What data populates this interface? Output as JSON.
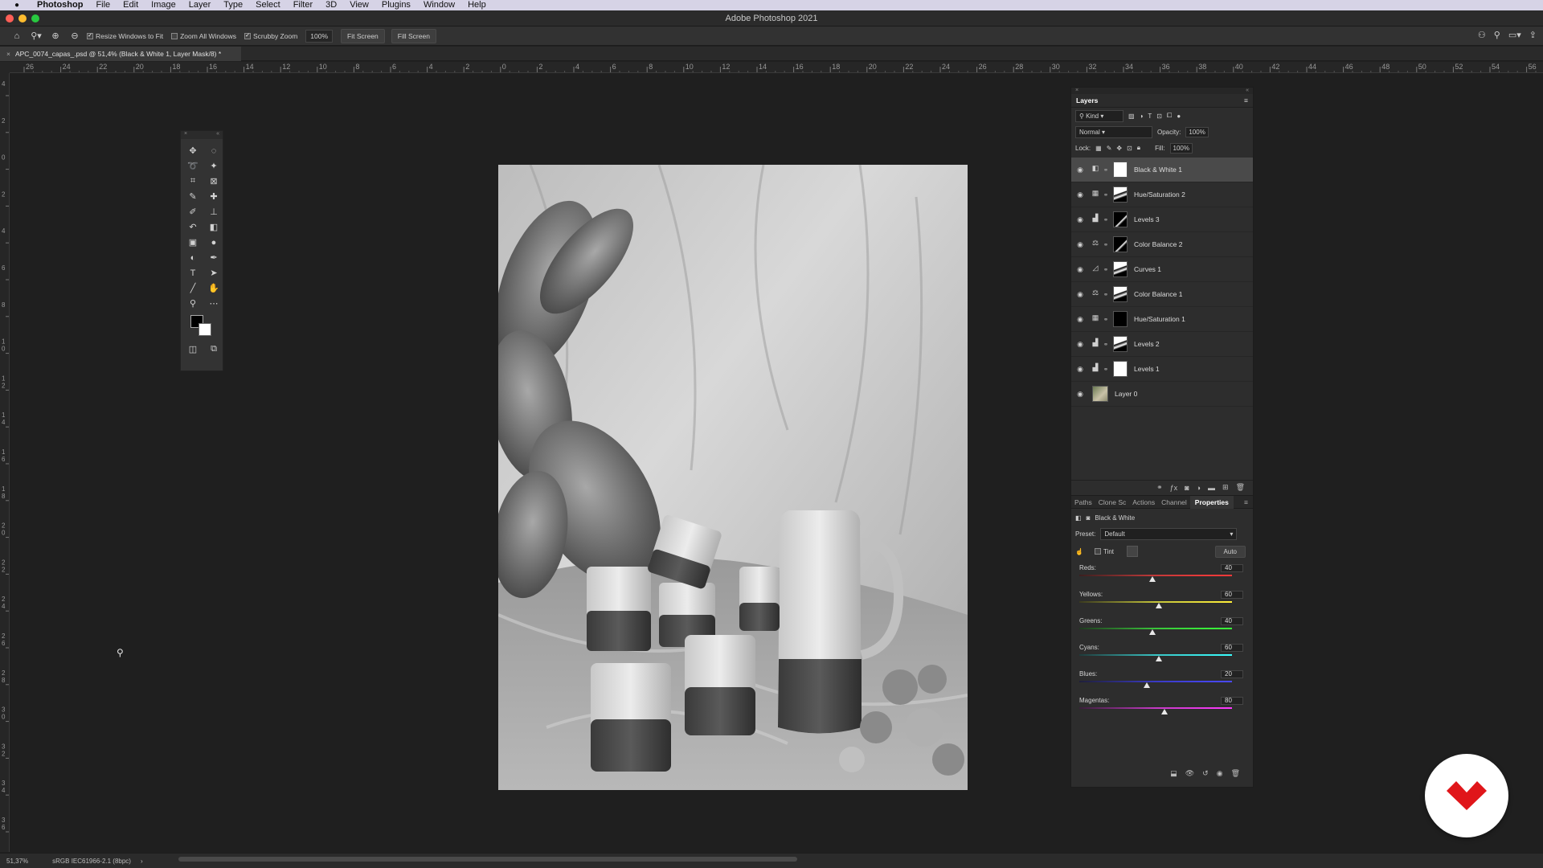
{
  "menubar": {
    "app": "Photoshop",
    "items": [
      "File",
      "Edit",
      "Image",
      "Layer",
      "Type",
      "Select",
      "Filter",
      "3D",
      "View",
      "Plugins",
      "Window",
      "Help"
    ]
  },
  "window": {
    "title": "Adobe Photoshop 2021"
  },
  "options": {
    "resize_windows": "Resize Windows to Fit",
    "zoom_all": "Zoom All Windows",
    "scrubby": "Scrubby Zoom",
    "zoom_value": "100%",
    "fit_screen": "Fit Screen",
    "fill_screen": "Fill Screen"
  },
  "document": {
    "tab_title": "APC_0074_capas_.psd @ 51,4% (Black & White 1, Layer Mask/8) *"
  },
  "rulers": {
    "h_ticks": [
      "26",
      "24",
      "22",
      "20",
      "18",
      "16",
      "14",
      "12",
      "10",
      "8",
      "6",
      "4",
      "2",
      "0",
      "2",
      "4",
      "6",
      "8",
      "10",
      "12",
      "14",
      "16",
      "18",
      "20",
      "22",
      "24",
      "26",
      "28",
      "30",
      "32",
      "34",
      "36",
      "38",
      "40",
      "42",
      "44",
      "46",
      "48",
      "50",
      "52",
      "54",
      "56"
    ],
    "v_ticks": [
      "4",
      "2",
      "0",
      "2",
      "4",
      "6",
      "8",
      "1\n0",
      "1\n2",
      "1\n4",
      "1\n6",
      "1\n8",
      "2\n0",
      "2\n2",
      "2\n4",
      "2\n6",
      "2\n8",
      "3\n0",
      "3\n2",
      "3\n4",
      "3\n6"
    ]
  },
  "layers_panel": {
    "tab": "Layers",
    "kind": "Kind",
    "blend_mode": "Normal",
    "opacity_label": "Opacity:",
    "opacity": "100%",
    "lock_label": "Lock:",
    "fill_label": "Fill:",
    "fill": "100%",
    "layers": [
      {
        "name": "Black & White 1",
        "icon": "bw-icon",
        "mask": "white",
        "selected": true
      },
      {
        "name": "Hue/Saturation 2",
        "icon": "huesat-icon",
        "mask": "mixed"
      },
      {
        "name": "Levels 3",
        "icon": "levels-icon",
        "mask": "dark"
      },
      {
        "name": "Color Balance 2",
        "icon": "colorbalance-icon",
        "mask": "dark"
      },
      {
        "name": "Curves 1",
        "icon": "curves-icon",
        "mask": "mixed"
      },
      {
        "name": "Color Balance 1",
        "icon": "colorbalance-icon",
        "mask": "mixed"
      },
      {
        "name": "Hue/Saturation 1",
        "icon": "huesat-icon",
        "mask": "black"
      },
      {
        "name": "Levels 2",
        "icon": "levels-icon",
        "mask": "mixed"
      },
      {
        "name": "Levels 1",
        "icon": "levels-icon",
        "mask": "white"
      },
      {
        "name": "Layer 0",
        "icon": "",
        "mask": "photo"
      }
    ]
  },
  "properties_tabs": [
    "Paths",
    "Clone Sc",
    "Actions",
    "Channel",
    "Properties"
  ],
  "properties": {
    "title": "Black & White",
    "preset_label": "Preset:",
    "preset": "Default",
    "tint": "Tint",
    "auto": "Auto",
    "sliders": [
      {
        "name": "Reds:",
        "value": 40,
        "pct": 0.48,
        "gradient": "linear-gradient(90deg,#3a1f1f,#c43a3a,#ff3a3a)"
      },
      {
        "name": "Yellows:",
        "value": 60,
        "pct": 0.52,
        "gradient": "linear-gradient(90deg,#3a3a1f,#c4c43a,#ffef3a)"
      },
      {
        "name": "Greens:",
        "value": 40,
        "pct": 0.48,
        "gradient": "linear-gradient(90deg,#1f3a1f,#3ac43a,#3aff3a)"
      },
      {
        "name": "Cyans:",
        "value": 60,
        "pct": 0.52,
        "gradient": "linear-gradient(90deg,#1f3a3a,#3ac4c4,#3affff)"
      },
      {
        "name": "Blues:",
        "value": 20,
        "pct": 0.44,
        "gradient": "linear-gradient(90deg,#1f1f3a,#3a3ac4,#4a4aff)"
      },
      {
        "name": "Magentas:",
        "value": 80,
        "pct": 0.56,
        "gradient": "linear-gradient(90deg,#3a1f3a,#c43ac4,#ff3aff)"
      }
    ]
  },
  "status": {
    "zoom": "51,37%",
    "profile": "sRGB IEC61966-2.1 (8bpc)"
  }
}
